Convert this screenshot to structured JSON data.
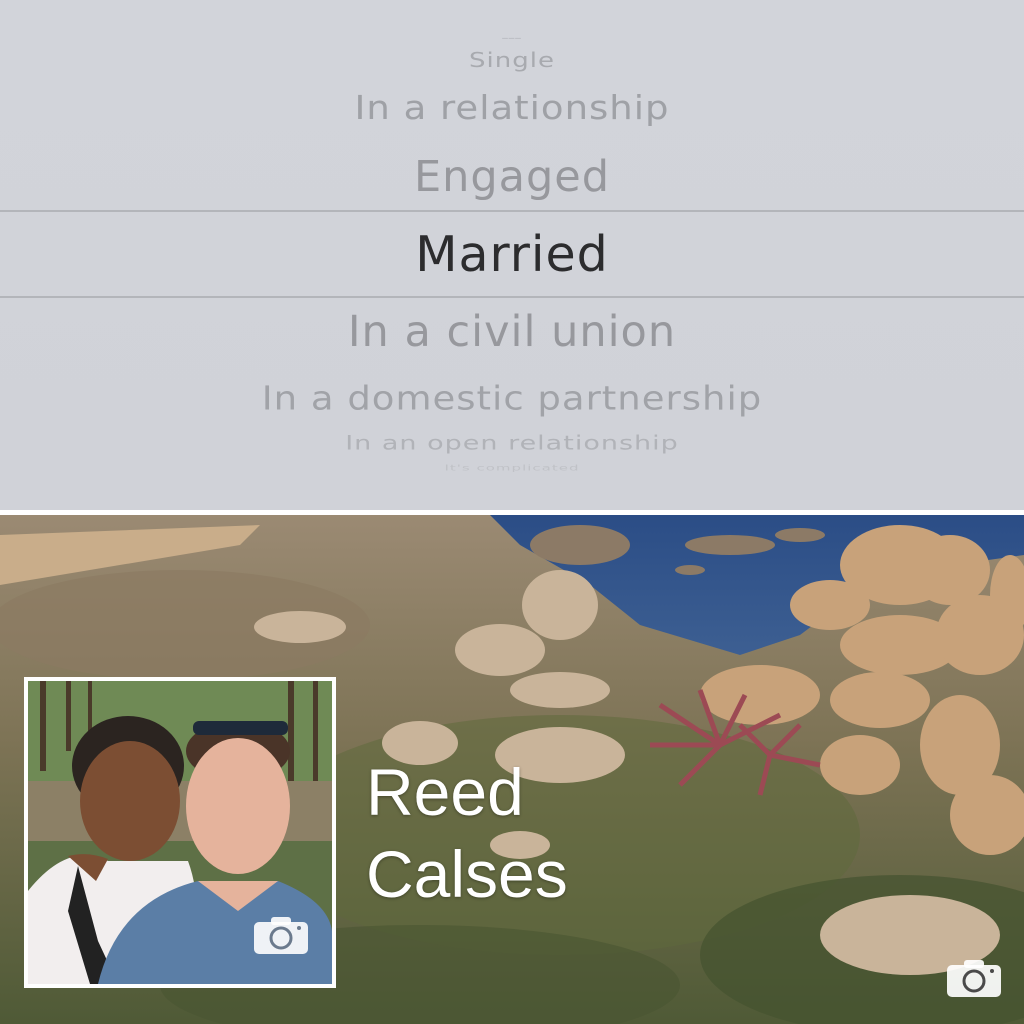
{
  "picker": {
    "options": [
      {
        "label": "Single"
      },
      {
        "label": "In a relationship"
      },
      {
        "label": "Engaged"
      },
      {
        "label": "Married",
        "selected": true
      },
      {
        "label": "In a civil union"
      },
      {
        "label": "In a domestic partnership"
      },
      {
        "label": "In an open relationship"
      },
      {
        "label": "It's complicated"
      }
    ]
  },
  "profile": {
    "first_name": "Reed",
    "last_name": "Calses"
  },
  "icons": {
    "profile_camera": "camera-icon",
    "cover_camera": "camera-icon"
  },
  "colors": {
    "picker_background": "#d1d3d9",
    "selected_text": "#2c2c2e",
    "unselected_text": "#97989d",
    "name_text": "#ffffff"
  }
}
